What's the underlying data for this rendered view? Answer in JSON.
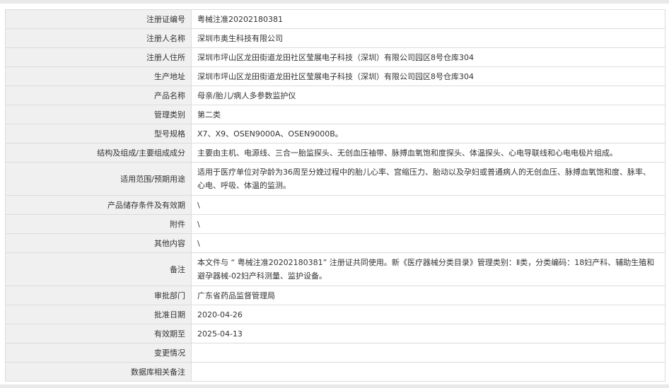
{
  "rows": [
    {
      "label": "注册证编号",
      "value": "粤械注准20202180381"
    },
    {
      "label": "注册人名称",
      "value": "深圳市奥生科技有限公司"
    },
    {
      "label": "注册人住所",
      "value": "深圳市坪山区龙田街道龙田社区莹展电子科技（深圳）有限公司园区8号仓库304"
    },
    {
      "label": "生产地址",
      "value": "深圳市坪山区龙田街道龙田社区莹展电子科技（深圳）有限公司园区8号仓库304"
    },
    {
      "label": "产品名称",
      "value": "母亲/胎儿/病人多参数监护仪"
    },
    {
      "label": "管理类别",
      "value": "第二类"
    },
    {
      "label": "型号规格",
      "value": "X7、X9、OSEN9000A、OSEN9000B。"
    },
    {
      "label": "结构及组成/主要组成成分",
      "value": "主要由主机、电源线、三合一胎监探头、无创血压袖带、脉搏血氧饱和度探头、体温探头、心电导联线和心电电极片组成。"
    },
    {
      "label": "适用范围/预期用途",
      "value": "适用于医疗单位对孕龄为36周至分娩过程中的胎儿心率、宫缩压力、胎动以及孕妇或普通病人的无创血压、脉搏血氧饱和度、脉率、心电、呼吸、体温的监测。"
    },
    {
      "label": "产品储存条件及有效期",
      "value": "\\"
    },
    {
      "label": "附件",
      "value": "\\"
    },
    {
      "label": "其他内容",
      "value": "\\"
    },
    {
      "label": "备注",
      "value": "本文件与 “ 粤械注准20202180381” 注册证共同使用。新《医疗器械分类目录》管理类别：Ⅱ类，分类编码：18妇产科、辅助生殖和避孕器械-02妇产科测量、监护设备。"
    },
    {
      "label": "审批部门",
      "value": "广东省药品监督管理局"
    },
    {
      "label": "批准日期",
      "value": "2020-04-26"
    },
    {
      "label": "有效期至",
      "value": "2025-04-13"
    },
    {
      "label": "变更情况",
      "value": ""
    },
    {
      "label": "数据库相关备注",
      "value": ""
    }
  ]
}
